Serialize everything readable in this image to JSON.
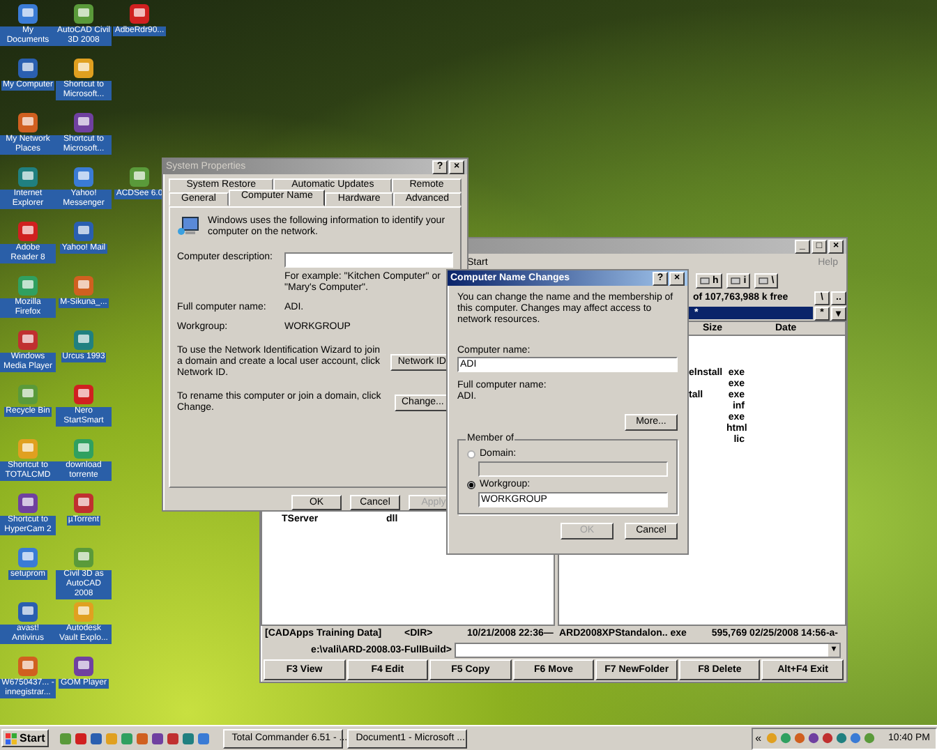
{
  "desktop_icons": [
    {
      "icons": [
        {
          "label": "My Documents"
        },
        {
          "label": "AutoCAD Civil 3D 2008"
        },
        {
          "label": "AdbeRdr90..."
        }
      ]
    },
    {
      "icons": [
        {
          "label": "My Computer"
        },
        {
          "label": "Shortcut to Microsoft..."
        }
      ]
    },
    {
      "icons": [
        {
          "label": "My Network Places"
        },
        {
          "label": "Shortcut to Microsoft..."
        }
      ]
    },
    {
      "icons": [
        {
          "label": "Internet Explorer"
        },
        {
          "label": "Yahoo! Messenger"
        },
        {
          "label": "ACDSee 6.0"
        }
      ]
    },
    {
      "icons": [
        {
          "label": "Adobe Reader 8"
        },
        {
          "label": "Yahoo! Mail"
        }
      ]
    },
    {
      "icons": [
        {
          "label": "Mozilla Firefox"
        },
        {
          "label": "M-Sikuna_..."
        }
      ]
    },
    {
      "icons": [
        {
          "label": "Windows Media Player"
        },
        {
          "label": "Urcus 1993"
        }
      ]
    },
    {
      "icons": [
        {
          "label": "Recycle Bin"
        },
        {
          "label": "Nero StartSmart"
        }
      ]
    },
    {
      "icons": [
        {
          "label": "Shortcut to TOTALCMD"
        },
        {
          "label": "download torrente"
        }
      ]
    },
    {
      "icons": [
        {
          "label": "Shortcut to HyperCam 2"
        },
        {
          "label": "µTorrent"
        }
      ]
    },
    {
      "icons": [
        {
          "label": "setuprom"
        },
        {
          "label": "Civil 3D as AutoCAD 2008"
        }
      ]
    },
    {
      "icons": [
        {
          "label": "avast! Antivirus"
        },
        {
          "label": "Autodesk Vault Explo..."
        }
      ]
    },
    {
      "icons": [
        {
          "label": "W6750437... - innegistrar..."
        },
        {
          "label": "GOM Player"
        }
      ]
    }
  ],
  "total_commander": {
    "window_buttons": [
      "_",
      "□",
      "×"
    ],
    "menu": [
      "Start",
      "Help"
    ],
    "toolbar": [
      {
        "label": "h"
      },
      {
        "label": "i"
      },
      {
        "label": "\\"
      }
    ],
    "free_space": "of 107,763,988 k free",
    "drive_buttons": [
      "\\",
      ".."
    ],
    "path": "*",
    "path_buttons": [
      "*",
      "▾"
    ],
    "columns": [
      "Size",
      "Date"
    ],
    "left_files": [
      {
        "name": "TServer",
        "ext": "dll"
      }
    ],
    "right_files": [
      {
        "name": "elnstall",
        "ext": "exe"
      },
      {
        "ext": "exe"
      },
      {
        "name": "tall",
        "ext": "exe"
      },
      {
        "ext": "inf"
      },
      {
        "ext": "exe"
      },
      {
        "ext": "html"
      },
      {
        "ext": "lic"
      }
    ],
    "left_status": [
      "[CADApps Training Data]",
      "<DIR>",
      "10/21/2008 22:36—"
    ],
    "right_status": [
      "ARD2008XPStandalon..  exe",
      "595,769 02/25/2008 14:56-a-"
    ],
    "command_path": "e:\\vali\\ARD-2008.03-FullBuild>",
    "command_button": "▾",
    "fkeys": [
      "F3 View",
      "F4 Edit",
      "F5 Copy",
      "F6 Move",
      "F7 NewFolder",
      "F8 Delete",
      "Alt+F4 Exit"
    ]
  },
  "system_properties": {
    "title": "System Properties",
    "title_buttons": [
      "?",
      "×"
    ],
    "tabs_back": [
      {
        "label": "System Restore",
        "selected": false
      },
      {
        "label": "Automatic Updates",
        "selected": false
      },
      {
        "label": "Remote",
        "selected": false
      }
    ],
    "tabs_front": [
      {
        "label": "General",
        "selected": false
      },
      {
        "label": "Computer Name",
        "selected": true
      },
      {
        "label": "Hardware",
        "selected": false
      },
      {
        "label": "Advanced",
        "selected": false
      }
    ],
    "intro": "Windows uses the following information to identify your computer on the network.",
    "description_label": "Computer description:",
    "example": "For example: \"Kitchen Computer\" or \"Mary's Computer\".",
    "full_name_label": "Full computer name:",
    "full_name": "ADI.",
    "workgroup_label": "Workgroup:",
    "workgroup": "WORKGROUP",
    "wizard_text": "To use the Network Identification Wizard to join a domain and create a local user account, click Network ID.",
    "wizard_button": "Network ID",
    "rename_text": "To rename this computer or join a domain, click Change.",
    "rename_button": "Change...",
    "buttons": [
      {
        "label": "OK",
        "disabled": false
      },
      {
        "label": "Cancel",
        "disabled": false
      },
      {
        "label": "Apply",
        "disabled": true
      }
    ]
  },
  "name_changes": {
    "title": "Computer Name Changes",
    "title_buttons": [
      "?",
      "×"
    ],
    "intro": "You can change the name and the membership of this computer. Changes may affect access to network resources.",
    "name_label": "Computer name:",
    "name_value": "ADI",
    "full_label": "Full computer name:",
    "full_value": "ADI.",
    "more_button": "More...",
    "group_label": "Member of",
    "options": [
      {
        "label": "Domain:",
        "selected": false
      },
      {
        "label": "Workgroup:",
        "selected": true,
        "value": "WORKGROUP"
      }
    ],
    "buttons": [
      {
        "label": "OK",
        "disabled": true
      },
      {
        "label": "Cancel",
        "disabled": false
      }
    ]
  },
  "taskbar": {
    "start": "Start",
    "tasks": [
      {
        "label": "Total Commander 6.51 - ...",
        "selected": false
      },
      {
        "label": "Document1 - Microsoft ...",
        "selected": false
      }
    ],
    "tray_chevron": "«",
    "clock": "10:40 PM"
  }
}
